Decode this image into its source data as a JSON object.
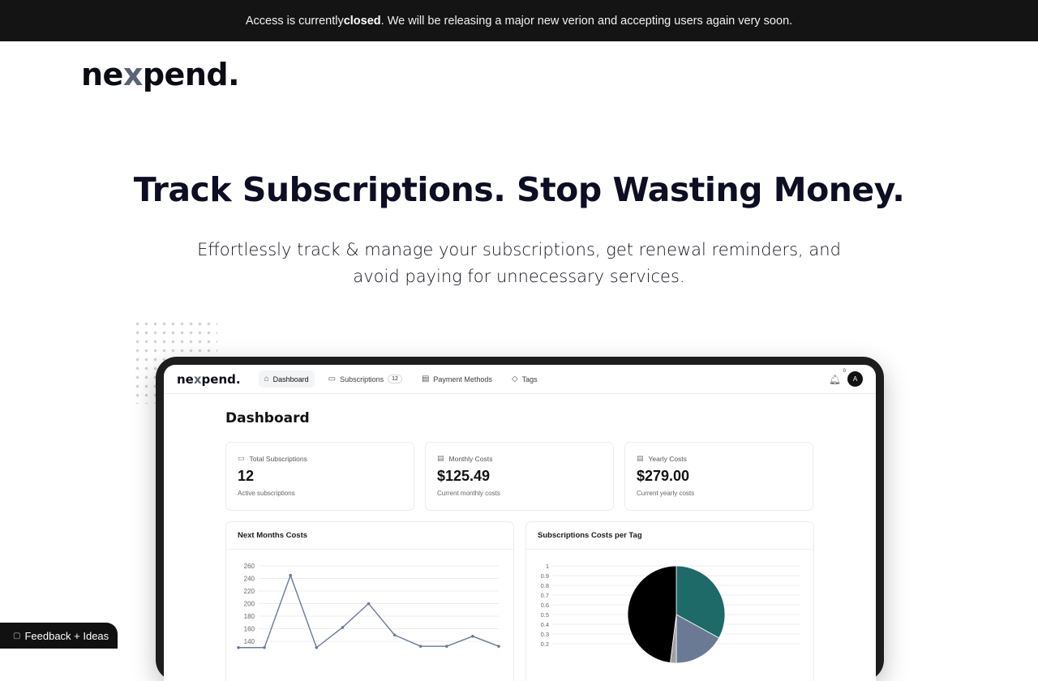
{
  "banner": {
    "pre": "Access is currently ",
    "bold": "closed",
    "post": ". We will be releasing a major new verion and accepting users again very soon."
  },
  "site": {
    "logo_pre": "ne",
    "logo_x": "x",
    "logo_post": "pend."
  },
  "hero": {
    "title": "Track Subscriptions. Stop Wasting Money.",
    "subtitle_line1": "Effortlessly track & manage your subscriptions, get renewal reminders, and",
    "subtitle_line2": "avoid paying for unnecessary services."
  },
  "app": {
    "logo_pre": "ne",
    "logo_x": "x",
    "logo_post": "pend.",
    "nav": {
      "dashboard": "Dashboard",
      "subscriptions": "Subscriptions",
      "subscriptions_count": "12",
      "payment_methods": "Payment Methods",
      "tags": "Tags"
    },
    "notifications_count": "0",
    "avatar_initial": "A",
    "page_title": "Dashboard",
    "stats": [
      {
        "label": "Total Subscriptions",
        "value": "12",
        "note": "Active subscriptions"
      },
      {
        "label": "Monthly Costs",
        "value": "$125.49",
        "note": "Current monthly costs"
      },
      {
        "label": "Yearly Costs",
        "value": "$279.00",
        "note": "Current yearly costs"
      }
    ],
    "panels": {
      "line_title": "Next Months Costs",
      "pie_title": "Subscriptions Costs per Tag"
    }
  },
  "feedback": {
    "label": "Feedback + Ideas"
  },
  "colors": {
    "banner_bg": "#141414",
    "line_series": "#6b7a94",
    "pie_slice_1": "#1d6a68",
    "pie_slice_2": "#6b7a94",
    "pie_slice_3": "#000000"
  },
  "chart_data": [
    {
      "type": "line",
      "title": "Next Months Costs",
      "x": [
        1,
        2,
        3,
        4,
        5,
        6,
        7,
        8,
        9,
        10,
        11
      ],
      "values": [
        130,
        130,
        245,
        130,
        162,
        200,
        150,
        132,
        132,
        148,
        132
      ],
      "yticks": [
        140,
        160,
        180,
        200,
        220,
        240,
        260
      ],
      "ylim": [
        130,
        260
      ],
      "grid": true
    },
    {
      "type": "pie",
      "title": "Subscriptions Costs per Tag",
      "values": [
        0.33,
        0.17,
        0.02,
        0.48
      ],
      "yticks": [
        0.2,
        0.3,
        0.4,
        0.5,
        0.6,
        0.7,
        0.8,
        0.9,
        1
      ],
      "grid": true
    }
  ]
}
